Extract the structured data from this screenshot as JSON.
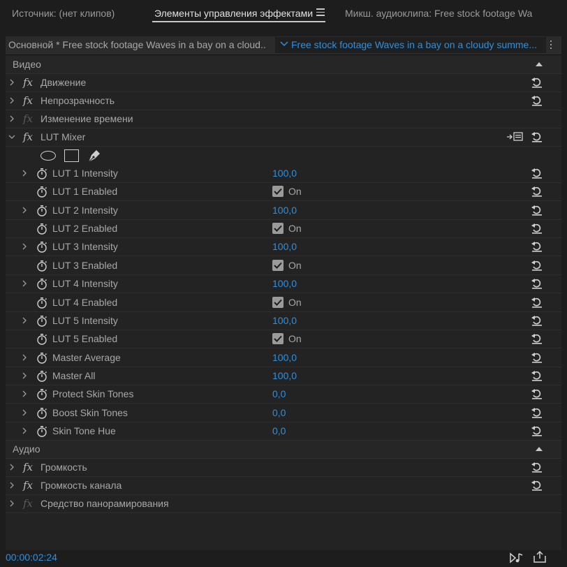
{
  "tabs": [
    {
      "label": "Источник: (нет клипов)"
    },
    {
      "label": "Элементы управления эффектами",
      "active": true
    },
    {
      "label": "Микш. аудиоклипа: Free stock footage Wa"
    }
  ],
  "source_bar": {
    "master_label": "Основной * Free stock footage Waves in a bay on a cloud...",
    "clip_label": "Free stock footage Waves in a bay on a cloudy summe..."
  },
  "video_section": {
    "title": "Видео",
    "effects": [
      {
        "label": "Движение",
        "fx_enabled": true
      },
      {
        "label": "Непрозрачность",
        "fx_enabled": true
      },
      {
        "label": "Изменение времени",
        "fx_enabled": false
      }
    ],
    "lut_mixer": {
      "label": "LUT Mixer",
      "params": [
        {
          "label": "LUT 1 Intensity",
          "value": "100,0",
          "type": "number"
        },
        {
          "label": "LUT 1 Enabled",
          "value": "On",
          "type": "checkbox",
          "checked": true
        },
        {
          "label": "LUT 2 Intensity",
          "value": "100,0",
          "type": "number"
        },
        {
          "label": "LUT 2 Enabled",
          "value": "On",
          "type": "checkbox",
          "checked": true
        },
        {
          "label": "LUT 3 Intensity",
          "value": "100,0",
          "type": "number"
        },
        {
          "label": "LUT 3 Enabled",
          "value": "On",
          "type": "checkbox",
          "checked": true
        },
        {
          "label": "LUT 4 Intensity",
          "value": "100,0",
          "type": "number"
        },
        {
          "label": "LUT 4 Enabled",
          "value": "On",
          "type": "checkbox",
          "checked": true
        },
        {
          "label": "LUT 5 Intensity",
          "value": "100,0",
          "type": "number"
        },
        {
          "label": "LUT 5 Enabled",
          "value": "On",
          "type": "checkbox",
          "checked": true
        },
        {
          "label": "Master Average",
          "value": "100,0",
          "type": "number"
        },
        {
          "label": "Master All",
          "value": "100,0",
          "type": "number"
        },
        {
          "label": "Protect Skin Tones",
          "value": "0,0",
          "type": "number"
        },
        {
          "label": "Boost Skin Tones",
          "value": "0,0",
          "type": "number"
        },
        {
          "label": "Skin Tone Hue",
          "value": "0,0",
          "type": "number"
        }
      ]
    }
  },
  "audio_section": {
    "title": "Аудио",
    "effects": [
      {
        "label": "Громкость",
        "fx_enabled": true
      },
      {
        "label": "Громкость канала",
        "fx_enabled": true
      },
      {
        "label": "Средство панорамирования",
        "fx_enabled": false
      }
    ]
  },
  "status": {
    "timecode": "00:00:02:24"
  },
  "icons": {
    "menu": "hamburger-menu-icon",
    "reset": "reset-parameter-icon",
    "stopwatch": "stopwatch-icon",
    "fx": "fx-badge-icon",
    "ellipse_mask": "ellipse-mask-icon",
    "rect_mask": "rectangle-mask-icon",
    "pen_mask": "pen-mask-icon",
    "settings": "effect-settings-icon",
    "play_audio": "play-audio-icon",
    "export": "export-frame-icon"
  },
  "colors": {
    "accent": "#2f8fdc",
    "background": "#232323",
    "text": "#a8a8a8"
  }
}
